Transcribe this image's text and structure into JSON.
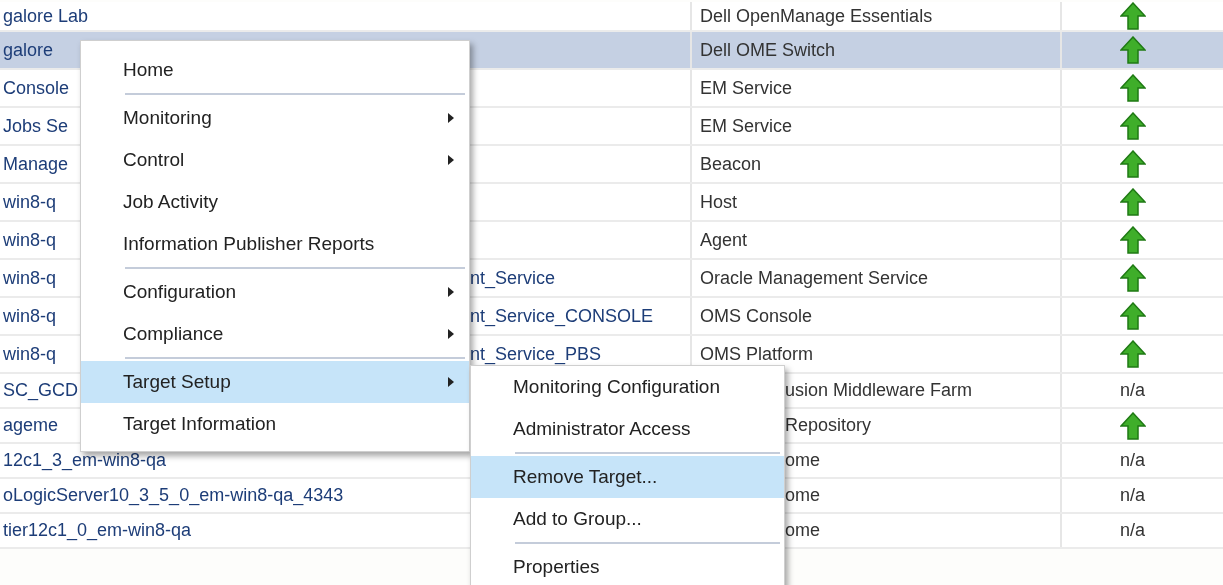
{
  "table": {
    "rows": [
      {
        "name": "galore Lab",
        "type": "Dell OpenManage Essentials",
        "status": {
          "kind": "up"
        },
        "selected": false
      },
      {
        "name": "galore",
        "type": "Dell OME Switch",
        "status": {
          "kind": "up"
        },
        "selected": true
      },
      {
        "name": "Console",
        "type": "EM Service",
        "status": {
          "kind": "up"
        },
        "selected": false
      },
      {
        "name": "Jobs Se",
        "type": "EM Service",
        "status": {
          "kind": "up"
        },
        "selected": false
      },
      {
        "name": "Manage",
        "type": "Beacon",
        "status": {
          "kind": "up"
        },
        "selected": false
      },
      {
        "name": "win8-q",
        "type": "Host",
        "status": {
          "kind": "up"
        },
        "selected": false
      },
      {
        "name": "win8-q",
        "type": "Agent",
        "status": {
          "kind": "up"
        },
        "selected": false
      },
      {
        "name": "win8-q",
        "name_tail": "nt_Service",
        "type": "Oracle Management Service",
        "status": {
          "kind": "up"
        },
        "selected": false
      },
      {
        "name": "win8-q",
        "name_tail": "nt_Service_CONSOLE",
        "type": "OMS Console",
        "status": {
          "kind": "up"
        },
        "selected": false
      },
      {
        "name": "win8-q",
        "name_tail": "nt_Service_PBS",
        "type": "OMS Platform",
        "status": {
          "kind": "up"
        },
        "selected": false
      },
      {
        "name": "SC_GCD",
        "type_tail": "usion Middleware Farm",
        "status": {
          "kind": "text",
          "text": "n/a"
        },
        "selected": false
      },
      {
        "name": "ageme",
        "type_tail": "Repository",
        "status": {
          "kind": "up"
        },
        "selected": false
      },
      {
        "name": "12c1_3_em-win8-qa",
        "type_tail": "ome",
        "status": {
          "kind": "text",
          "text": "n/a"
        },
        "selected": false
      },
      {
        "name": "oLogicServer10_3_5_0_em-win8-qa_4343",
        "type_tail": "ome",
        "status": {
          "kind": "text",
          "text": "n/a"
        },
        "selected": false
      },
      {
        "name": "tier12c1_0_em-win8-qa",
        "type_tail": "ome",
        "status": {
          "kind": "text",
          "text": "n/a"
        },
        "selected": false
      }
    ]
  },
  "context_menu": {
    "items": [
      {
        "label": "Home",
        "submenu": false,
        "selected": false,
        "separator_after": true
      },
      {
        "label": "Monitoring",
        "submenu": true,
        "selected": false,
        "separator_after": false
      },
      {
        "label": "Control",
        "submenu": true,
        "selected": false,
        "separator_after": false
      },
      {
        "label": "Job Activity",
        "submenu": false,
        "selected": false,
        "separator_after": false
      },
      {
        "label": "Information Publisher Reports",
        "submenu": false,
        "selected": false,
        "separator_after": true
      },
      {
        "label": "Configuration",
        "submenu": true,
        "selected": false,
        "separator_after": false
      },
      {
        "label": "Compliance",
        "submenu": true,
        "selected": false,
        "separator_after": true
      },
      {
        "label": "Target Setup",
        "submenu": true,
        "selected": true,
        "separator_after": false
      },
      {
        "label": "Target Information",
        "submenu": false,
        "selected": false,
        "separator_after": false
      }
    ]
  },
  "submenu": {
    "items": [
      {
        "label": "Monitoring Configuration",
        "selected": false,
        "separator_after": false
      },
      {
        "label": "Administrator Access",
        "selected": false,
        "separator_after": true
      },
      {
        "label": "Remove Target...",
        "selected": true,
        "separator_after": false
      },
      {
        "label": "Add to Group...",
        "selected": false,
        "separator_after": true
      },
      {
        "label": "Properties",
        "selected": false,
        "separator_after": false
      }
    ]
  }
}
